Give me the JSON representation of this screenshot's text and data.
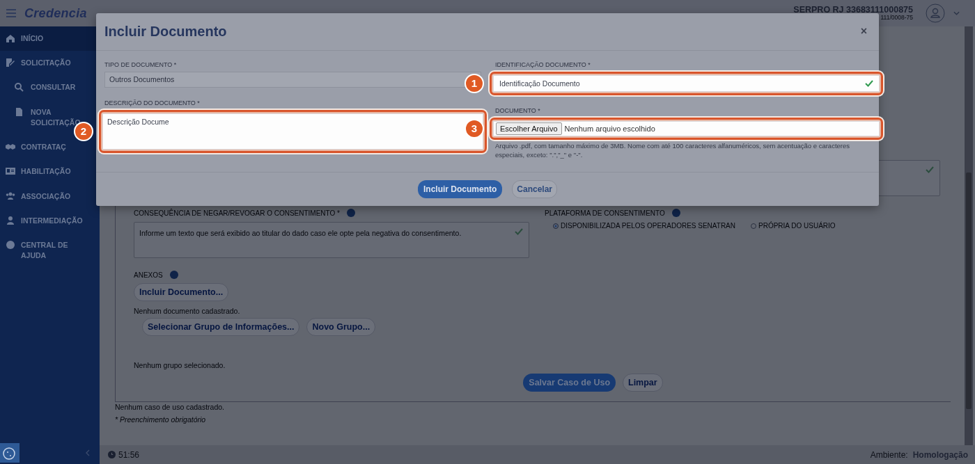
{
  "header": {
    "logo": "Credencia",
    "org_name": "SERPRO RJ 33683111000875",
    "org_id": "111/0008-75"
  },
  "sidebar": {
    "items": [
      {
        "label": "INÍCIO",
        "selected": true
      },
      {
        "label": "SOLICITAÇÃO",
        "selected": false,
        "children": [
          {
            "label": "CONSULTAR",
            "selected": false
          },
          {
            "label": "NOVA SOLICITAÇÃO",
            "selected": false
          }
        ]
      },
      {
        "label": "CONTRATAÇ",
        "selected": false
      },
      {
        "label": "HABILITAÇÃO",
        "selected": false
      },
      {
        "label": "ASSOCIAÇÃO",
        "selected": false
      },
      {
        "label": "INTERMEDIAÇÃO",
        "selected": false
      },
      {
        "label": "CENTRAL DE AJUDA",
        "selected": false
      }
    ]
  },
  "form": {
    "consequence": {
      "label": "CONSEQUÊNCIA DE NEGAR/REVOGAR O CONSENTIMENTO *",
      "placeholder": "Informe um texto que será exibido ao titular do dado caso ele opte pela negativa do consentimento."
    },
    "platform": {
      "label": "PLATAFORMA DE CONSENTIMENTO",
      "options": [
        {
          "label": "DISPONIBILIZADA PELOS OPERADORES SENATRAN",
          "selected": true
        },
        {
          "label": "PRÓPRIA DO USUÁRIO",
          "selected": false
        }
      ]
    },
    "attachments": {
      "label": "ANEXOS",
      "button": "Incluir Documento...",
      "empty": "Nenhum documento cadastrado."
    },
    "group_select": "Selecionar Grupo de Informações...",
    "new_group": "Novo Grupo...",
    "no_group": "Nenhum grupo selecionado.",
    "save": "Salvar Caso de Uso",
    "clear": "Limpar",
    "no_use_case": "Nenhum caso de uso cadastrado.",
    "required_note": "* Preenchimento obrigatório"
  },
  "modal": {
    "title": "Incluir Documento",
    "close": "×",
    "type": {
      "label": "TIPO DE DOCUMENTO *",
      "value": "Outros Documentos"
    },
    "description": {
      "label": "DESCRIÇÃO DO DOCUMENTO *",
      "value": "Descrição Docume",
      "highlighted": true,
      "callout": "2"
    },
    "identification": {
      "label": "IDENTIFICAÇÃO DOCUMENTO *",
      "value": "Identificação Documento",
      "valid": true,
      "highlighted": true,
      "callout": "1"
    },
    "document": {
      "label": "DOCUMENTO *",
      "button": "Escolher Arquivo",
      "status": "Nenhum arquivo escolhido",
      "help": "Arquivo .pdf, com tamanho máximo de 3MB. Nome com até 100 caracteres alfanuméricos, sem acentuação e caracteres especiais, exceto: \".\",\"_\" e \"-\".",
      "highlighted": true,
      "callout": "3"
    },
    "buttons": [
      {
        "label": "Incluir Documento",
        "kind": "primary"
      },
      {
        "label": "Cancelar",
        "kind": "secondary"
      }
    ]
  },
  "footer": {
    "timer": "51:56",
    "env_label": "Ambiente:",
    "env_value": "Homologação"
  }
}
